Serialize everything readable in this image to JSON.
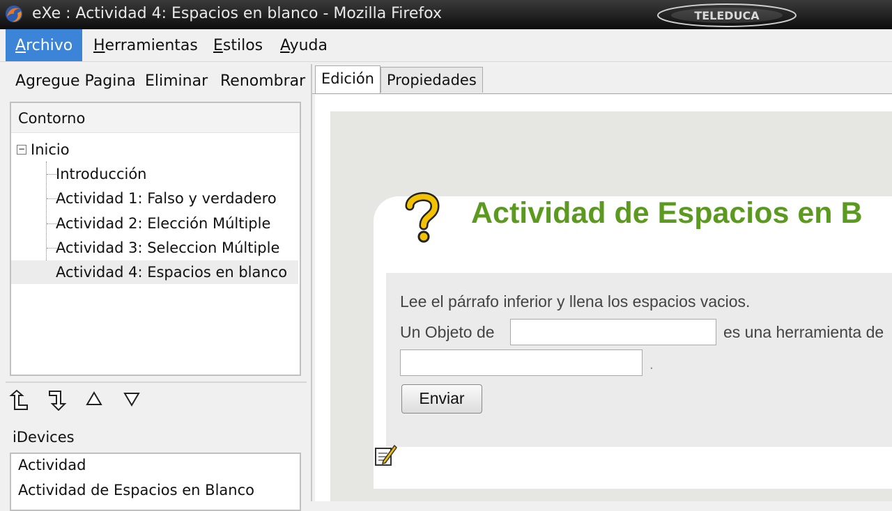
{
  "window": {
    "title": "eXe : Actividad 4: Espacios en blanco - Mozilla Firefox",
    "watermark": "TELEDUCA"
  },
  "menubar": {
    "items": [
      {
        "label": "Archivo",
        "active": true
      },
      {
        "label": "Herramientas",
        "active": false
      },
      {
        "label": "Estilos",
        "active": false
      },
      {
        "label": "Ayuda",
        "active": false
      }
    ]
  },
  "left_toolbar": {
    "add_page": "Agregue Pagina",
    "delete": "Eliminar",
    "rename": "Renombrar"
  },
  "outline": {
    "header": "Contorno",
    "root": "Inicio",
    "nodes": [
      "Introducción",
      "Actividad 1: Falso y verdadero",
      "Actividad 2: Elección Múltiple",
      "Actividad 3: Seleccion Múltiple",
      "Actividad 4: Espacios en blanco"
    ],
    "selected_index": 4
  },
  "move_buttons": [
    "promote-icon",
    "demote-icon",
    "move-up-icon",
    "move-down-icon"
  ],
  "idevices": {
    "header": "iDevices",
    "items": [
      "Actividad",
      "Actividad de Espacios en Blanco"
    ]
  },
  "tabs": [
    {
      "label": "Edición",
      "active": true
    },
    {
      "label": "Propiedades",
      "active": false
    }
  ],
  "idevice_content": {
    "title": "Actividad de Espacios en B",
    "instructions": "Lee el párrafo inferior y llena los espacios vacios.",
    "sentence_before": "Un Objeto de",
    "sentence_after": "es una herramienta de",
    "blank_1_value": "",
    "blank_2_value": "",
    "submit_label": "Enviar"
  },
  "colors": {
    "title_green": "#5b9a1f",
    "menu_active": "#3b84d8",
    "question_mark_yellow": "#f2c200"
  }
}
